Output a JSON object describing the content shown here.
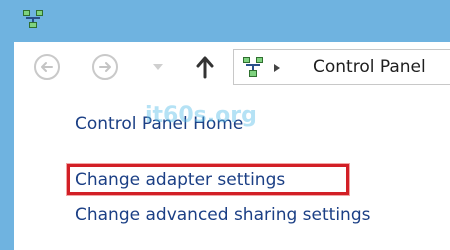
{
  "titlebar": {
    "icon": "network-icon"
  },
  "toolbar": {
    "back_icon": "back-arrow-icon",
    "forward_icon": "forward-arrow-icon",
    "history_icon": "chevron-down-icon",
    "up_icon": "up-arrow-icon"
  },
  "address": {
    "icon": "network-icon",
    "separator_icon": "breadcrumb-arrow-icon",
    "path": "Control Panel"
  },
  "tasks": {
    "home": "Control Panel Home",
    "adapter": "Change adapter settings",
    "sharing": "Change advanced sharing settings"
  },
  "watermark": "it60s.org",
  "colors": {
    "frame": "#6fb3e0",
    "link": "#1b3f85",
    "highlight": "#d21f26"
  }
}
